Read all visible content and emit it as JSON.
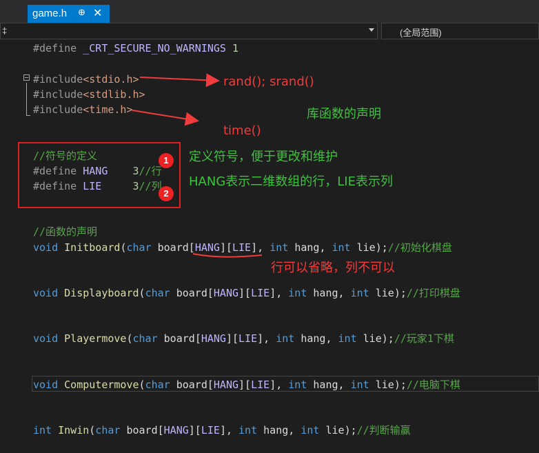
{
  "tab": {
    "filename": "game.h",
    "pin_icon": "pin-icon",
    "close_icon": "close-icon"
  },
  "nav": {
    "left_fragment": "‡",
    "scope": "(全局范围)"
  },
  "code": {
    "l1_directive": "#define",
    "l1_macro": "_CRT_SECURE_NO_WARNINGS",
    "l1_value": "1",
    "inc1_directive": "#include",
    "inc1_file": "<stdio.h>",
    "inc2_directive": "#include",
    "inc2_file": "<stdlib.h>",
    "inc3_directive": "#include",
    "inc3_file": "<time.h>",
    "comment_define": "//符号的定义",
    "def_hang_directive": "#define",
    "def_hang_name": "HANG",
    "def_hang_value": "3",
    "def_hang_comment": "//行",
    "def_lie_directive": "#define",
    "def_lie_name": "LIE",
    "def_lie_value": "3",
    "def_lie_comment": "//列",
    "comment_decl": "//函数的声明",
    "f1_ret": "void",
    "f1_name": "Initboard",
    "f1_comment": "//初始化棋盘",
    "f2_ret": "void",
    "f2_name": "Displayboard",
    "f2_comment": "//打印棋盘",
    "f3_ret": "void",
    "f3_name": "Playermove",
    "f3_comment": "//玩家1下棋",
    "f4_ret": "void",
    "f4_name": "Computermove",
    "f4_comment": "//电脑下棋",
    "f5_ret": "int",
    "f5_name": "Inwin",
    "f5_comment": "//判断输赢",
    "p_char": "char",
    "p_board": "board",
    "p_hang_arr": "HANG",
    "p_lie_arr": "LIE",
    "p_int": "int",
    "p_hang": "hang",
    "p_lie": "lie"
  },
  "annotations": {
    "rand": "rand(); srand()",
    "time": "time()",
    "lib_decl": "库函数的声明",
    "define_note": "定义符号，便于更改和维护",
    "hang_lie_note": "HANG表示二维数组的行，LIE表示列",
    "omit_note": "行可以省略，列不可以",
    "badge1": "1",
    "badge2": "2"
  },
  "colors": {
    "accent": "#007acc",
    "annotation_red": "#f03c3c",
    "annotation_green": "#3ec23e"
  }
}
